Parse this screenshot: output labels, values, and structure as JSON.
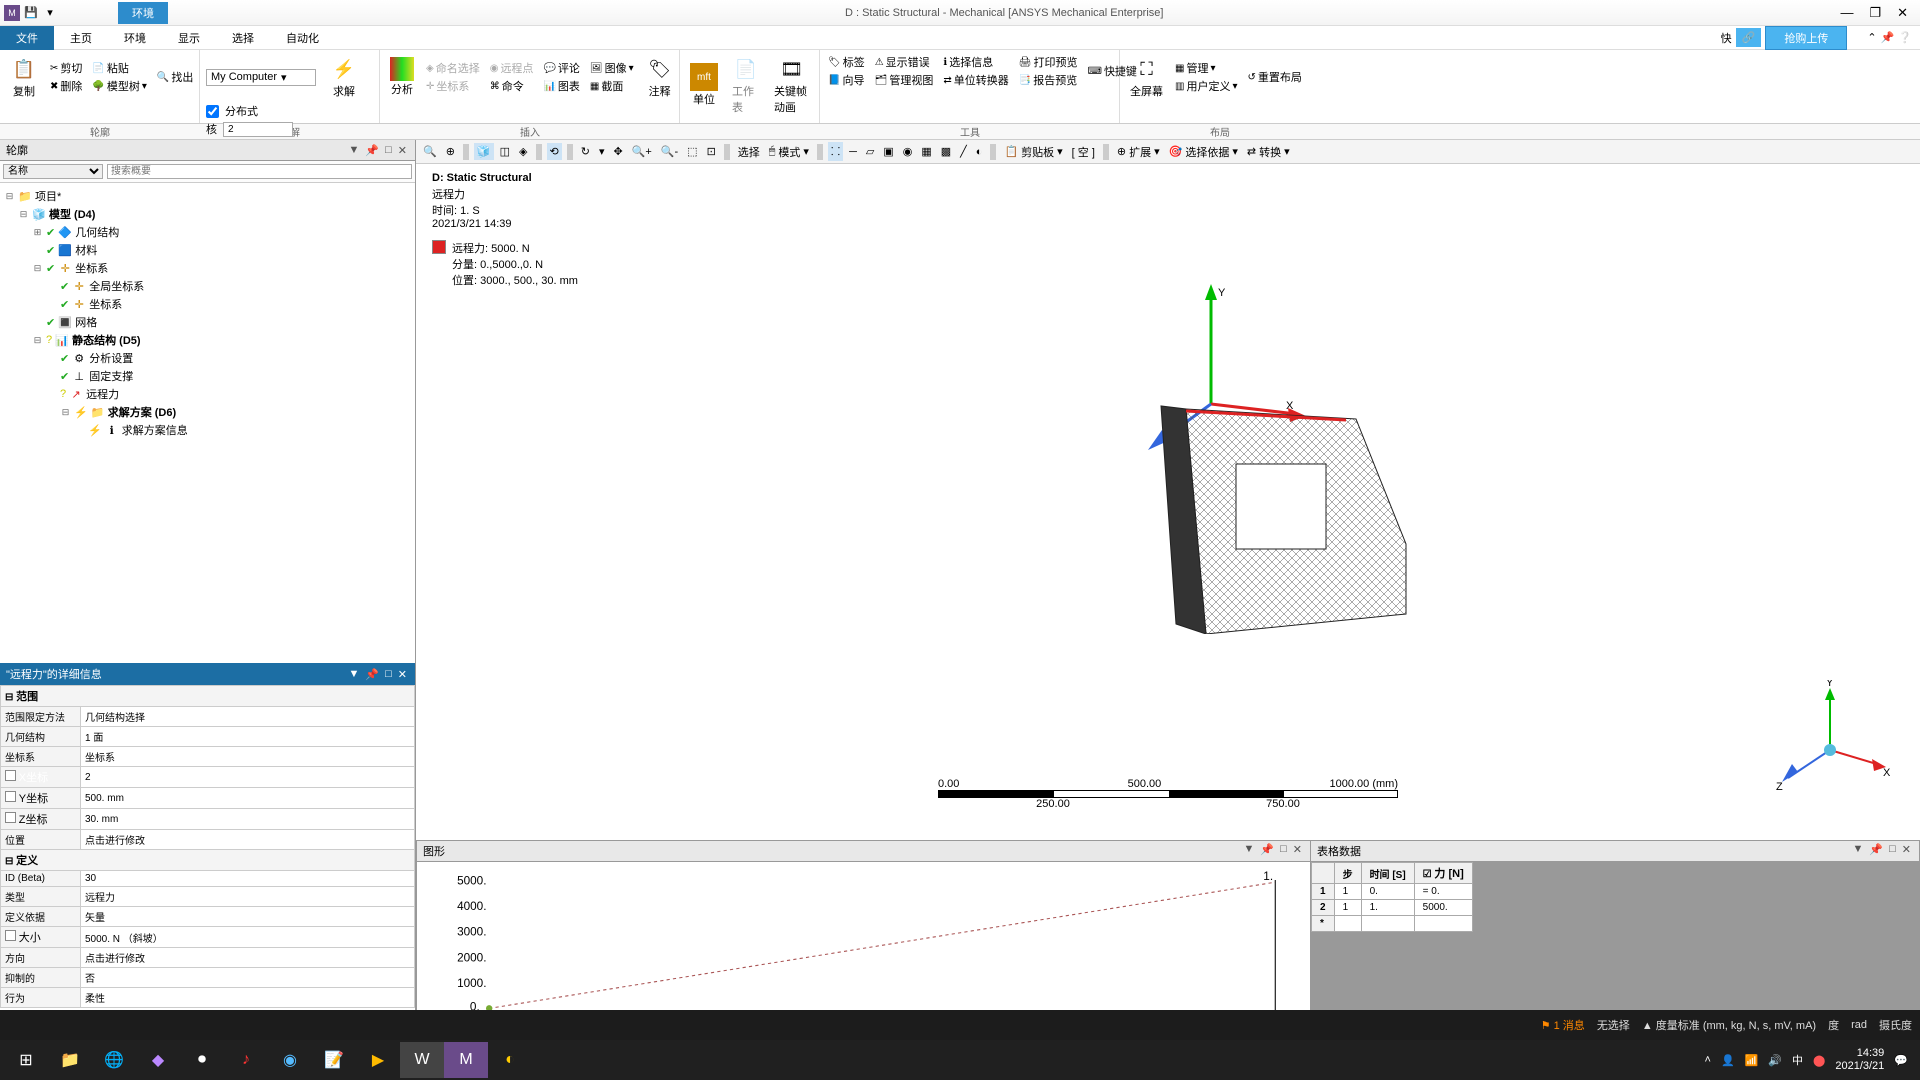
{
  "window": {
    "title": "D : Static Structural - Mechanical [ANSYS Mechanical Enterprise]",
    "context_tab": "环境"
  },
  "menu": {
    "file": "文件",
    "home": "主页",
    "env": "环境",
    "display": "显示",
    "select": "选择",
    "auto": "自动化",
    "quick": "快",
    "upload": "抢购上传"
  },
  "ribbon": {
    "g1": {
      "label": "轮廓",
      "copy": "复制",
      "cut": "剪切",
      "paste": "粘贴",
      "find": "找出",
      "delete": "删除",
      "modeltree": "模型树"
    },
    "g2": {
      "combo": "My Computer",
      "dist": "分布式",
      "cores_lbl": "核",
      "cores": "2",
      "solve": "求解",
      "label": "求解"
    },
    "g3": {
      "analysis": "分析",
      "named": "命名选择",
      "remote": "远程点",
      "comment": "评论",
      "image": "图像",
      "annot": "注释",
      "coord": "坐标系",
      "cmd": "命令",
      "chart": "图表",
      "section": "截面",
      "label": "插入"
    },
    "g4": {
      "unit": "单位",
      "ws": "工作表",
      "kf": "关键帧动画"
    },
    "g5": {
      "tag": "标签",
      "errors": "显示错误",
      "selinfo": "选择信息",
      "printprev": "打印预览",
      "wizard": "快捷键",
      "guide": "向导",
      "mgmt": "管理视图",
      "unitconv": "单位转换器",
      "report": "报告预览",
      "label": "工具"
    },
    "g6": {
      "full": "全屏幕",
      "mgmt": "管理",
      "reset": "重置布局",
      "user": "用户定义",
      "label": "布局"
    }
  },
  "toolbar3d": {
    "select": "选择",
    "mode": "模式",
    "clip": "剪贴板",
    "empty": "[ 空 ]",
    "extend": "扩展",
    "selby": "选择依据",
    "convert": "转换"
  },
  "outline": {
    "title": "轮廓",
    "filter_name": "名称",
    "search_ph": "搜索概要",
    "project": "项目*",
    "model": "模型 (D4)",
    "geom": "几何结构",
    "materials": "材料",
    "coord": "坐标系",
    "global_cs": "全局坐标系",
    "cs": "坐标系",
    "mesh": "网格",
    "static": "静态结构 (D5)",
    "analysis_settings": "分析设置",
    "fixed": "固定支撑",
    "remote_force": "远程力",
    "solution": "求解方案 (D6)",
    "sol_info": "求解方案信息"
  },
  "details": {
    "title": "\"远程力\"的详细信息",
    "scope": "范围",
    "scope_method_lbl": "范围限定方法",
    "scope_method": "几何结构选择",
    "geom_lbl": "几何结构",
    "geom": "1 面",
    "coord_lbl": "坐标系",
    "coord": "坐标系",
    "x_lbl": "X坐标",
    "x": "2",
    "y_lbl": "Y坐标",
    "y": "500. mm",
    "z_lbl": "Z坐标",
    "z": "30. mm",
    "loc_lbl": "位置",
    "loc": "点击进行修改",
    "def": "定义",
    "id_lbl": "ID (Beta)",
    "id": "30",
    "type_lbl": "类型",
    "type": "远程力",
    "defby_lbl": "定义依据",
    "defby": "矢量",
    "mag_lbl": "大小",
    "mag": "5000. N （斜坡）",
    "dir_lbl": "方向",
    "dir": "点击进行修改",
    "supp_lbl": "抑制的",
    "supp": "否",
    "beh_lbl": "行为",
    "beh": "柔性"
  },
  "view": {
    "title": "D: Static Structural",
    "load": "远程力",
    "time": "时间: 1. S",
    "date": "2021/3/21 14:39",
    "legend1": "远程力: 5000. N",
    "legend2": "分量: 0.,5000.,0. N",
    "legend3": "位置: 3000., 500., 30. mm",
    "ruler": {
      "a": "0.00",
      "b": "500.00",
      "c": "1000.00 (mm)",
      "d": "250.00",
      "e": "750.00"
    }
  },
  "graph": {
    "title": "图形"
  },
  "table": {
    "title": "表格数据",
    "h1": "步",
    "h2": "时间 [S]",
    "h3": "力 [N]",
    "rows": [
      {
        "i": "1",
        "step": "1",
        "time": "0.",
        "force": "= 0."
      },
      {
        "i": "2",
        "step": "1",
        "time": "1.",
        "force": "5000."
      }
    ]
  },
  "chart_data": {
    "type": "line",
    "x": [
      0,
      1
    ],
    "y": [
      0,
      5000
    ],
    "ylim": [
      0,
      5000
    ],
    "xlim": [
      0,
      1
    ],
    "yticks": [
      0,
      1000,
      2000,
      3000,
      4000,
      5000
    ],
    "xticks": [
      "1."
    ],
    "xlabel": "",
    "ylabel": ""
  },
  "status": {
    "msg": "1 消息",
    "nosel": "无选择",
    "units": "度量标准 (mm, kg, N, s, mV, mA)",
    "deg": "度",
    "rad": "rad",
    "cel": "摄氏度"
  },
  "clock": {
    "time": "14:39",
    "date": "2021/3/21"
  }
}
